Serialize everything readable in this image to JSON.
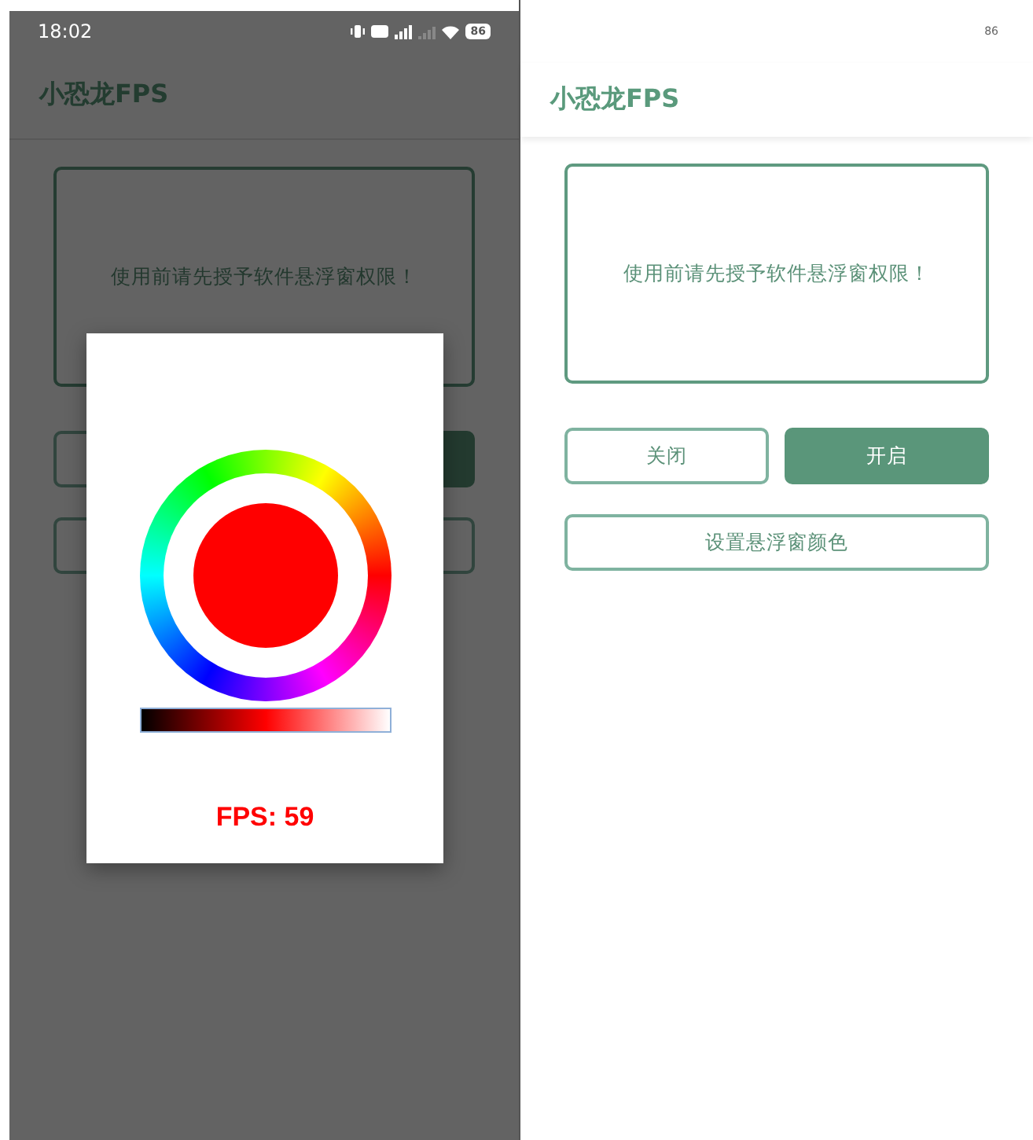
{
  "left_screen": {
    "status_bar": {
      "time": "18:02",
      "battery": "86"
    },
    "app_bar": {
      "title": "小恐龙FPS"
    },
    "notice": "使用前请先授予软件悬浮窗权限！",
    "buttons": [
      {
        "kind": "outline"
      },
      {
        "kind": "filled"
      },
      {
        "kind": "outline"
      }
    ],
    "dialog": {
      "picker": {
        "color": "#ff0000"
      },
      "fps": "FPS: 59"
    }
  },
  "right_screen": {
    "status_bar": {
      "battery": "86"
    },
    "app_bar": {
      "title": "小恐龙FPS"
    },
    "notice": "使用前请先授予软件悬浮窗权限！",
    "buttons": [
      {
        "label": "关闭",
        "kind": "outline"
      },
      {
        "label": "开启",
        "kind": "filled"
      },
      {
        "label": "设置悬浮窗颜色",
        "kind": "outline"
      }
    ]
  }
}
